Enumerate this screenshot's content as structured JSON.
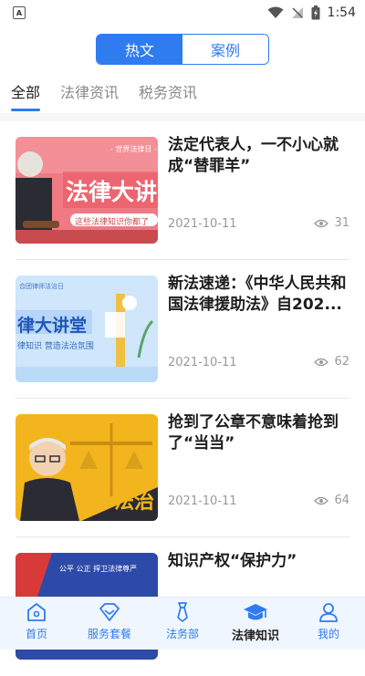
{
  "status_bar": {
    "time": "1:54",
    "left_badge": "A"
  },
  "segment": {
    "options": [
      "热文",
      "案例"
    ],
    "active_index": 0
  },
  "tabs": [
    "全部",
    "法律资讯",
    "税务资讯"
  ],
  "articles": [
    {
      "title": "法定代表人，一不小心就成“替罪羊”",
      "date": "2021-10-11",
      "views": "31",
      "thumb": {
        "heading": "法律大讲",
        "sub": "- 世界法律日 -",
        "caption": "这些法律知识你都了"
      }
    },
    {
      "title": "新法速递：《中华人民共和国法律援助法》自202...",
      "date": "2021-10-11",
      "views": "62",
      "thumb": {
        "heading": "律大讲堂",
        "sub": "合团律师法治日",
        "caption": "律知识 营造法治氛围"
      }
    },
    {
      "title": "抢到了公章不意味着抢到了“当当”",
      "date": "2021-10-11",
      "views": "64",
      "thumb": {
        "heading": "法治"
      }
    },
    {
      "title": "知识产权“保护力”",
      "date": "",
      "views": "",
      "thumb": {
        "caption": "公平 公正 捍卫法律尊严"
      }
    }
  ],
  "bottom_nav": [
    {
      "label": "首页",
      "icon": "home-icon"
    },
    {
      "label": "服务套餐",
      "icon": "diamond-icon"
    },
    {
      "label": "法务部",
      "icon": "tie-icon"
    },
    {
      "label": "法律知识",
      "icon": "graduation-cap-icon",
      "active": true
    },
    {
      "label": "我的",
      "icon": "user-icon"
    }
  ],
  "colors": {
    "accent": "#2f7bf0",
    "nav_bg": "#f0f6ff"
  }
}
